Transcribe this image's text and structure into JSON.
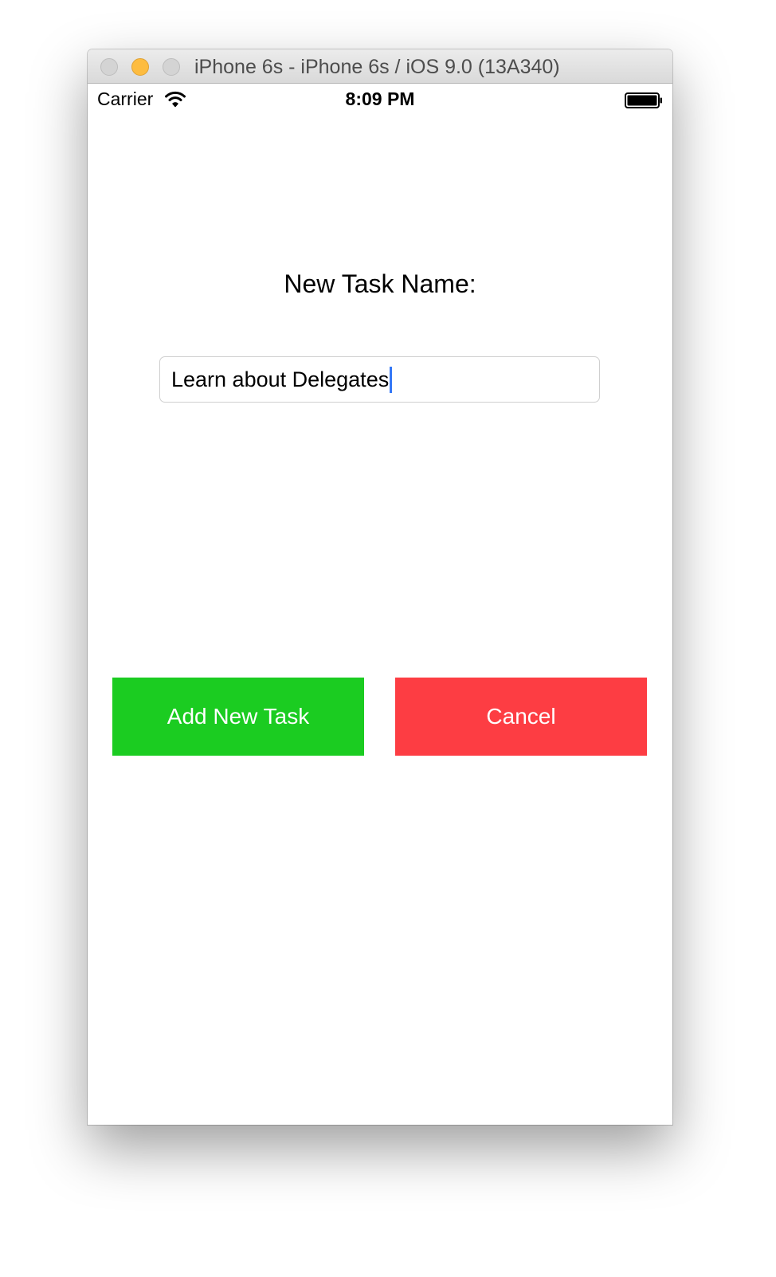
{
  "window": {
    "title": "iPhone 6s - iPhone 6s / iOS 9.0 (13A340)"
  },
  "status_bar": {
    "carrier": "Carrier",
    "time": "8:09 PM",
    "icons": [
      "wifi-icon",
      "battery-icon"
    ]
  },
  "form": {
    "label": "New Task Name:",
    "input_value": "Learn about Delegates"
  },
  "buttons": {
    "add_label": "Add New Task",
    "cancel_label": "Cancel"
  },
  "colors": {
    "add_button": "#1bcc21",
    "cancel_button": "#fd3d43",
    "cursor": "#3478f6",
    "minimize_light": "#fdbc40"
  }
}
